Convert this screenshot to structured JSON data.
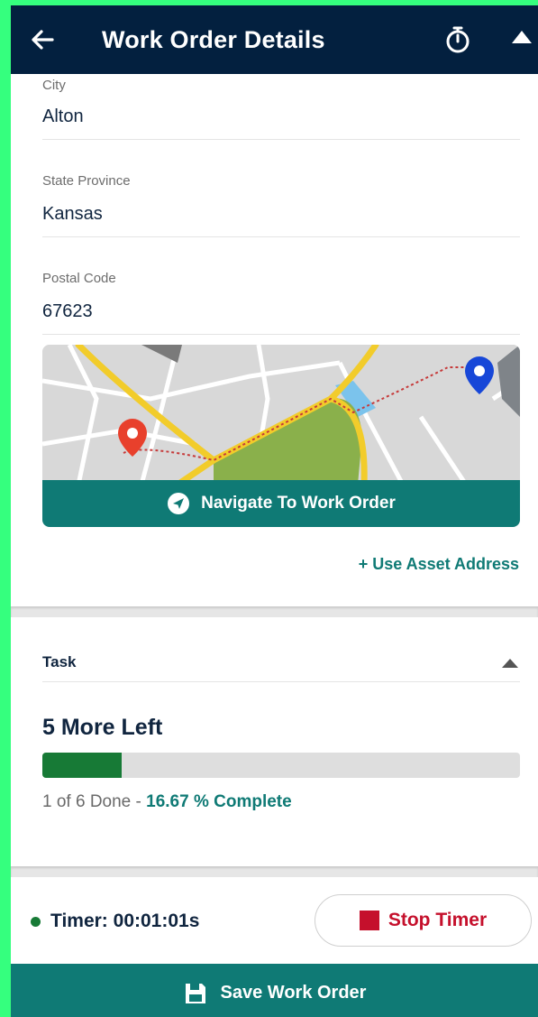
{
  "header": {
    "title": "Work Order Details",
    "back_icon": "arrow-left-icon",
    "timer_icon": "stopwatch-icon",
    "collapse_icon": "caret-up-icon"
  },
  "address": {
    "city": {
      "label": "City",
      "value": "Alton"
    },
    "state": {
      "label": "State Province",
      "value": "Kansas"
    },
    "postal": {
      "label": "Postal Code",
      "value": "67623"
    }
  },
  "map": {
    "navigate_label": "Navigate To Work Order",
    "use_asset_label": "+ Use Asset Address"
  },
  "task": {
    "header_label": "Task",
    "remaining_label": "5 More Left",
    "done_text": "1 of 6 Done",
    "separator": " - ",
    "percent_text": "16.67 % Complete",
    "progress_fraction": 0.1667
  },
  "timer": {
    "label": "Timer: 00:01:01s",
    "stop_label": "Stop Timer"
  },
  "footer": {
    "save_label": "Save Work Order"
  },
  "colors": {
    "header_bg": "#03203f",
    "accent": "#0f7a75",
    "progress_fill": "#177a36",
    "stop_red": "#c5102c",
    "outer_border": "#35ff7e"
  }
}
